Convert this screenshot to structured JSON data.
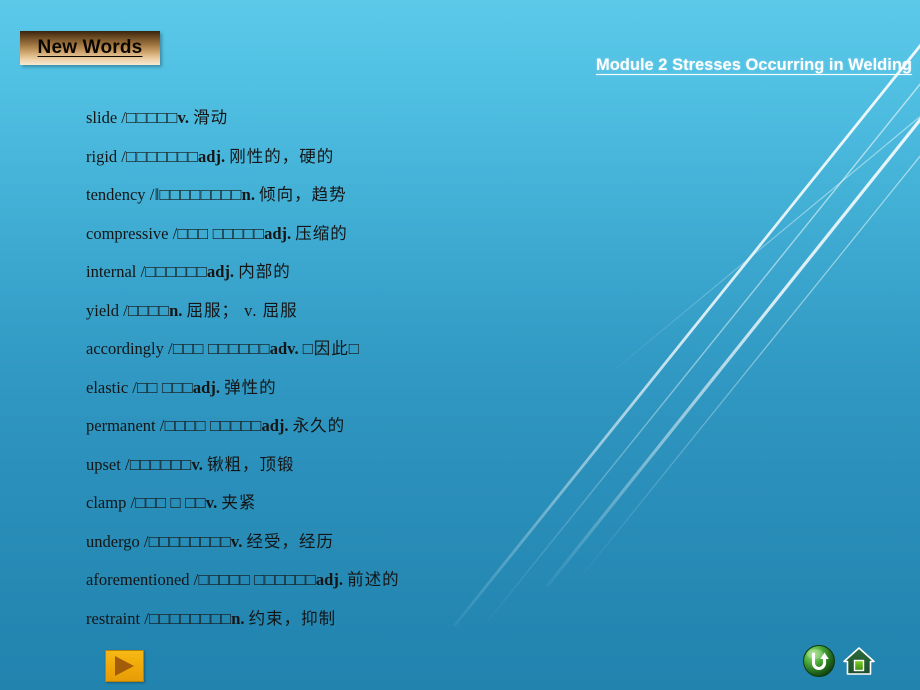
{
  "slide": {
    "title_box_label": "New Words",
    "module_header": "Module 2  Stresses Occurring in Welding",
    "background": {
      "top_color": "#5cc9e9",
      "bottom_color": "#2183ae",
      "streak_color": "#ffffff"
    },
    "title_box_colors": {
      "gradient_top": "#3a2410",
      "gradient_bottom": "#f7e9d2",
      "text_color": "#0a0600"
    }
  },
  "words": [
    {
      "term": "slide",
      "phonetic": "/□□□□□",
      "pos": "v.",
      "cn": "滑动"
    },
    {
      "term": "rigid",
      "phonetic": "/□□□□□□□",
      "pos": "adj.",
      "cn": "刚性的，硬的"
    },
    {
      "term": "tendency",
      "phonetic": "/‖□□□□□□□□",
      "pos": "n.",
      "cn": "倾向，趋势"
    },
    {
      "term": "compressive",
      "phonetic": "/□□□ □□□□□",
      "pos": "adj.",
      "cn": "压缩的"
    },
    {
      "term": "internal",
      "phonetic": "/□□□□□□",
      "pos": "adj.",
      "cn": "内部的"
    },
    {
      "term": "yield",
      "phonetic": "/□□□□",
      "pos": "n.",
      "cn": "屈服；  v.  屈服"
    },
    {
      "term": "accordingly",
      "phonetic": "/□□□ □□□□□□",
      "pos": "adv.",
      "cn": "□因此□"
    },
    {
      "term": "elastic",
      "phonetic": "/□□ □□□",
      "pos": "adj.",
      "cn": "弹性的"
    },
    {
      "term": "permanent",
      "phonetic": "/□□□□ □□□□□",
      "pos": "adj.",
      "cn": "永久的"
    },
    {
      "term": "upset",
      "phonetic": "/□□□□□□",
      "pos": "v.",
      "cn": "锹粗，顶锻"
    },
    {
      "term": "clamp",
      "phonetic": "/□□□ □ □□",
      "pos": "v.",
      "cn": "夹紧"
    },
    {
      "term": "undergo",
      "phonetic": "/□□□□□□□□",
      "pos": "v.",
      "cn": "经受，经历"
    },
    {
      "term": "aforementioned",
      "phonetic": "/□□□□□ □□□□□□",
      "pos": "adj.",
      "cn": "前述的"
    },
    {
      "term": "restraint",
      "phonetic": "/□□□□□□□□",
      "pos": "n.",
      "cn": "约束，抑制"
    }
  ],
  "controls": {
    "next_button": {
      "icon": "play-triangle-icon",
      "color": "#f0a90a"
    },
    "return_button": {
      "icon": "return-arrow-icon",
      "color": "#2f8a2f"
    },
    "home_button": {
      "icon": "home-icon",
      "color": "#2f6e3a"
    }
  }
}
